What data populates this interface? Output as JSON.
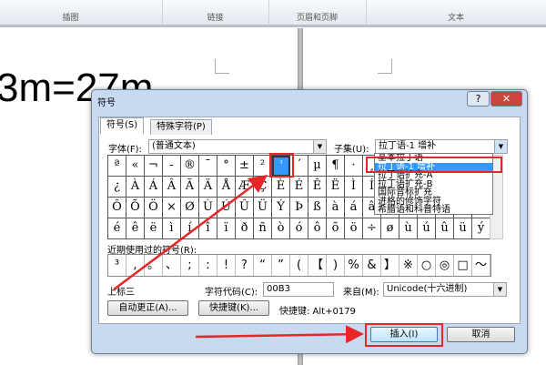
{
  "ribbon": {
    "groups": [
      "插图",
      "链接",
      "页眉和页脚",
      "文本"
    ]
  },
  "document": {
    "text": "3m=27m"
  },
  "dialog": {
    "title": "符号",
    "help": "?",
    "close": "✕",
    "tabs": [
      "符号(S)",
      "特殊字符(P)"
    ],
    "font_label": "字体(F):",
    "font_value": "(普通文本)",
    "subset_label": "子集(U):",
    "subset_value": "拉丁语-1 增补",
    "subset_options": [
      "基本拉丁语",
      "拉丁语-1 增补",
      "拉丁语扩充-A",
      "拉丁语扩充-B",
      "国际音标扩充",
      "进格的修饰字符",
      "希腊语和科普特语"
    ],
    "subset_selected": 1,
    "symbols": [
      "ª",
      "«",
      "¬",
      "-",
      "®",
      "¯",
      "°",
      "±",
      "²",
      "³",
      "´",
      "µ",
      "¶",
      "·",
      "¸",
      "¹",
      "º",
      "»",
      "¼",
      "½",
      "¾",
      "¿",
      "À",
      "Á",
      "Â",
      "Ã",
      "Ä",
      "Å",
      "Æ",
      "Ç",
      "È",
      "É",
      "Ê",
      "Ë",
      "Ì",
      "Í",
      "Î",
      "Ï",
      "Ð",
      "Ñ",
      "Ò",
      "Ó",
      "Ô",
      "Õ",
      "Ö",
      "×",
      "Ø",
      "Ù",
      "Ú",
      "Û",
      "Ü",
      "Ý",
      "Þ",
      "ß",
      "à",
      "á",
      "â",
      "ã",
      "ä",
      "å",
      "æ",
      "ç",
      "è",
      "é",
      "ê",
      "ë",
      "ì",
      "í",
      "î",
      "ï",
      "ð",
      "ñ",
      "ò",
      "ó",
      "ô",
      "õ",
      "ö",
      "÷",
      "ø",
      "ù",
      "ú",
      "û",
      "ü",
      "ý"
    ],
    "selected_symbol": "³",
    "recent_label": "近期使用过的符号(R):",
    "recent": [
      "³",
      ",",
      "。",
      "、",
      ";",
      ":",
      "!",
      "?",
      "“",
      "”",
      "(",
      "【",
      ")",
      "%",
      "&",
      "】",
      "※",
      "○",
      "◎",
      "□",
      "～"
    ],
    "char_name": "上标三",
    "code_label": "字符代码(C):",
    "code_value": "00B3",
    "from_label": "来自(M):",
    "from_value": "Unicode(十六进制)",
    "autocorrect": "自动更正(A)...",
    "shortcut_btn": "快捷键(K)...",
    "shortcut_text": "快捷键: Alt+0179",
    "insert": "插入(I)",
    "cancel": "取消"
  },
  "colors": {
    "selection": "#3399ff",
    "annotation": "#e8262a"
  }
}
